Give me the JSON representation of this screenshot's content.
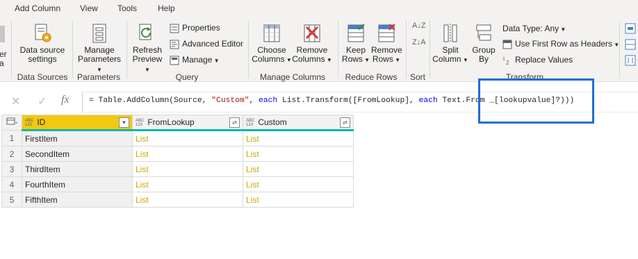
{
  "menu": [
    "Add Column",
    "View",
    "Tools",
    "Help"
  ],
  "ribbon": {
    "partial_left": [
      "er",
      "a"
    ],
    "data_source_settings": "Data source settings",
    "manage_parameters": "Manage Parameters",
    "refresh_preview": "Refresh Preview",
    "properties": "Properties",
    "advanced_editor": "Advanced Editor",
    "manage": "Manage",
    "choose_columns": "Choose Columns",
    "remove_columns": "Remove Columns",
    "keep_rows": "Keep Rows",
    "remove_rows": "Remove Rows",
    "sort_az": "A↓Z",
    "sort_za": "Z↓A",
    "split_column": "Split Column",
    "group_by": "Group By",
    "data_type": "Data Type: Any",
    "use_first_row": "Use First Row as Headers",
    "replace_values": "Replace Values",
    "groups": {
      "data_sources": "Data Sources",
      "parameters": "Parameters",
      "query": "Query",
      "manage_columns": "Manage Columns",
      "reduce_rows": "Reduce Rows",
      "sort": "Sort",
      "transform": "Transform"
    }
  },
  "formula": {
    "cancel": "✕",
    "commit": "✓",
    "fx": "fx",
    "p1": "= Table.AddColumn(Source, ",
    "s1": "\"Custom\"",
    "p2": ", ",
    "k1": "each",
    "p3": " List.Transform([FromLookup], ",
    "k2": "each",
    "p4": " Text.From _[lookupvalue]?)))"
  },
  "table": {
    "type_label": "ABC\n123",
    "columns": [
      "ID",
      "FromLookup",
      "Custom"
    ],
    "rows": [
      {
        "n": "1",
        "id": "FirstItem",
        "a": "List",
        "b": "List"
      },
      {
        "n": "2",
        "id": "SecondItem",
        "a": "List",
        "b": "List"
      },
      {
        "n": "3",
        "id": "ThirdItem",
        "a": "List",
        "b": "List"
      },
      {
        "n": "4",
        "id": "FourthItem",
        "a": "List",
        "b": "List"
      },
      {
        "n": "5",
        "id": "FifthItem",
        "a": "List",
        "b": "List"
      }
    ]
  },
  "colors": {
    "accent_yellow": "#f2c811",
    "teal": "#01b8aa",
    "highlight_box": "#1e6fd1",
    "list_text": "#c8a800"
  }
}
